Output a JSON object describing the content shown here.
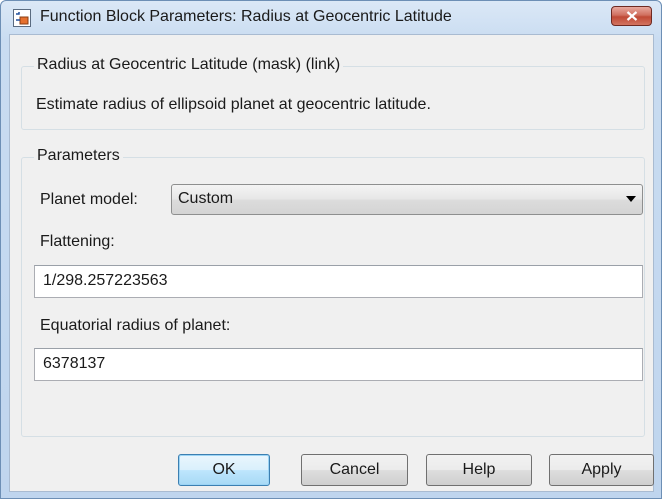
{
  "window": {
    "title": "Function Block Parameters: Radius at Geocentric Latitude",
    "app_icon": "simulink-block-icon",
    "close_icon": "close-x-icon"
  },
  "description": {
    "header": "Radius at Geocentric Latitude (mask) (link)",
    "text": "Estimate radius of ellipsoid planet at geocentric latitude."
  },
  "parameters": {
    "group_label": "Parameters",
    "planet_model_label": "Planet model:",
    "planet_model_value": "Custom",
    "flattening_label": "Flattening:",
    "flattening_value": "1/298.257223563",
    "equatorial_radius_label": "Equatorial radius of planet:",
    "equatorial_radius_value": "6378137"
  },
  "buttons": {
    "ok": "OK",
    "cancel": "Cancel",
    "help": "Help",
    "apply": "Apply"
  },
  "colors": {
    "title_bar": "#c9dcf1",
    "close_button": "#c94c37",
    "dialog_background": "#f0f0f0",
    "default_button_border": "#3c7fb1"
  }
}
